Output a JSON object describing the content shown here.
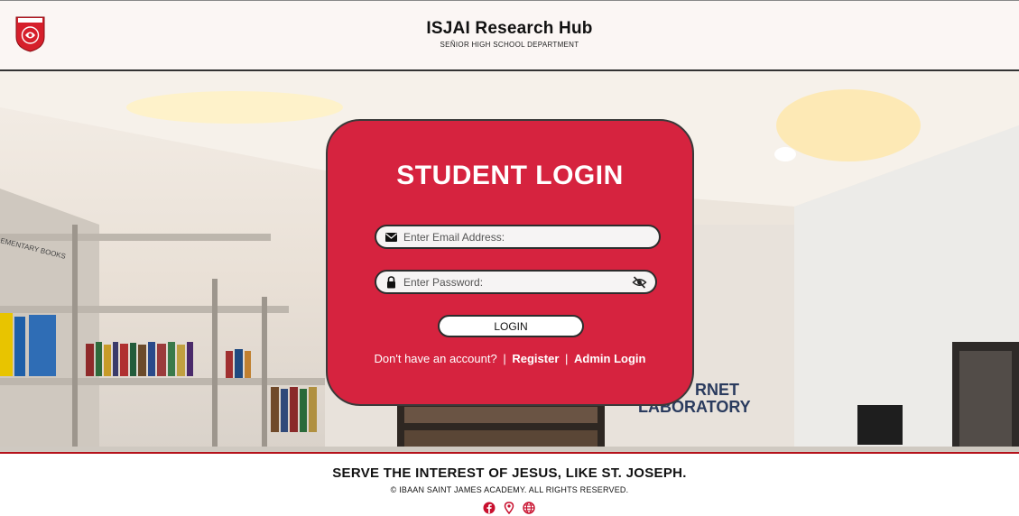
{
  "header": {
    "title": "ISJAI Research Hub",
    "subtitle": "SEÑIOR HIGH SCHOOL DEPARTMENT",
    "logo_icon": "school-seal-logo"
  },
  "background": {
    "sign_line1": "RNET",
    "sign_line2": "LABORATORY",
    "shelf_sign": "EMENTARY BOOKS"
  },
  "login": {
    "title": "STUDENT LOGIN",
    "email_placeholder": "Enter Email Address:",
    "email_value": "",
    "email_icon": "envelope-icon",
    "password_placeholder": "Enter Password:",
    "password_value": "",
    "password_icon": "lock-icon",
    "toggle_icon": "eye-slash-icon",
    "button_label": "LOGIN",
    "no_account_text": "Don't have an account?",
    "separator": "|",
    "register_label": "Register",
    "admin_label": "Admin Login"
  },
  "footer": {
    "motto": "SERVE THE INTEREST OF JESUS, LIKE ST. JOSEPH.",
    "copyright": "© IBAAN SAINT JAMES ACADEMY. ALL RIGHTS RESERVED.",
    "icons": [
      "facebook-icon",
      "location-pin-icon",
      "globe-icon"
    ]
  },
  "colors": {
    "accent": "#d6233f",
    "header_bg": "#fbf6f4",
    "footer_line": "#b5121b"
  }
}
